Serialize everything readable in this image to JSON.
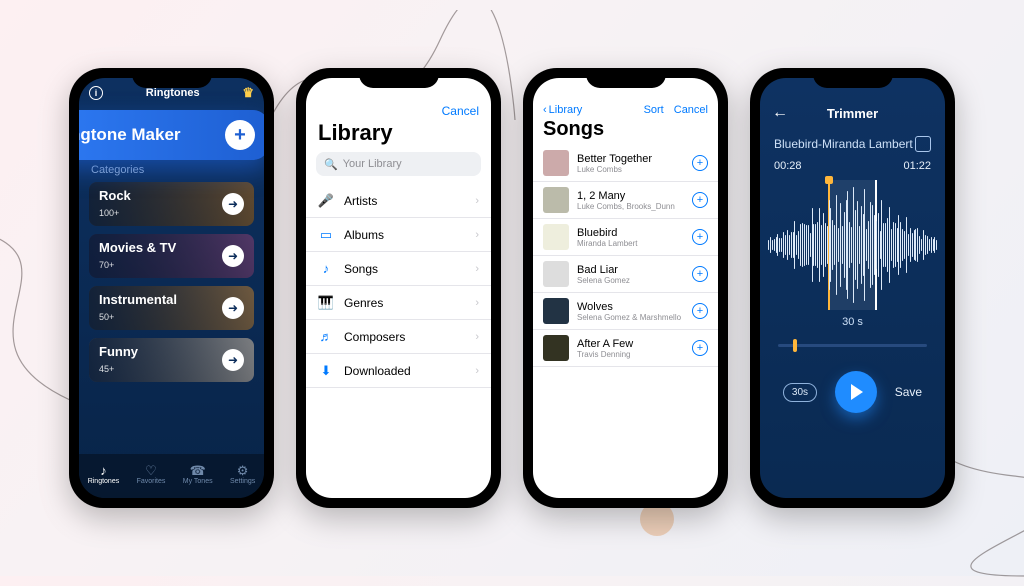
{
  "phone1": {
    "header_title": "Ringtones",
    "maker_label": "Ringtone Maker",
    "section_label": "Categories",
    "categories": [
      {
        "name": "Rock",
        "count": "100+"
      },
      {
        "name": "Movies & TV",
        "count": "70+"
      },
      {
        "name": "Instrumental",
        "count": "50+"
      },
      {
        "name": "Funny",
        "count": "45+"
      }
    ],
    "tabs": [
      {
        "label": "Ringtones"
      },
      {
        "label": "Favorites"
      },
      {
        "label": "My Tones"
      },
      {
        "label": "Settings"
      }
    ]
  },
  "phone2": {
    "cancel": "Cancel",
    "title": "Library",
    "search_placeholder": "Your Library",
    "rows": [
      {
        "label": "Artists"
      },
      {
        "label": "Albums"
      },
      {
        "label": "Songs"
      },
      {
        "label": "Genres"
      },
      {
        "label": "Composers"
      },
      {
        "label": "Downloaded"
      }
    ]
  },
  "phone3": {
    "back": "Library",
    "sort": "Sort",
    "cancel": "Cancel",
    "title": "Songs",
    "songs": [
      {
        "title": "Better Together",
        "artist": "Luke Combs"
      },
      {
        "title": "1, 2 Many",
        "artist": "Luke Combs, Brooks_Dunn"
      },
      {
        "title": "Bluebird",
        "artist": "Miranda Lambert"
      },
      {
        "title": "Bad Liar",
        "artist": "Selena Gomez"
      },
      {
        "title": "Wolves",
        "artist": "Selena Gomez & Marshmello"
      },
      {
        "title": "After A Few",
        "artist": "Travis Denning"
      }
    ]
  },
  "phone4": {
    "title": "Trimmer",
    "track": "Bluebird-Miranda Lambert",
    "time_start": "00:28",
    "time_end": "01:22",
    "duration": "30 s",
    "preset": "30s",
    "save": "Save"
  }
}
